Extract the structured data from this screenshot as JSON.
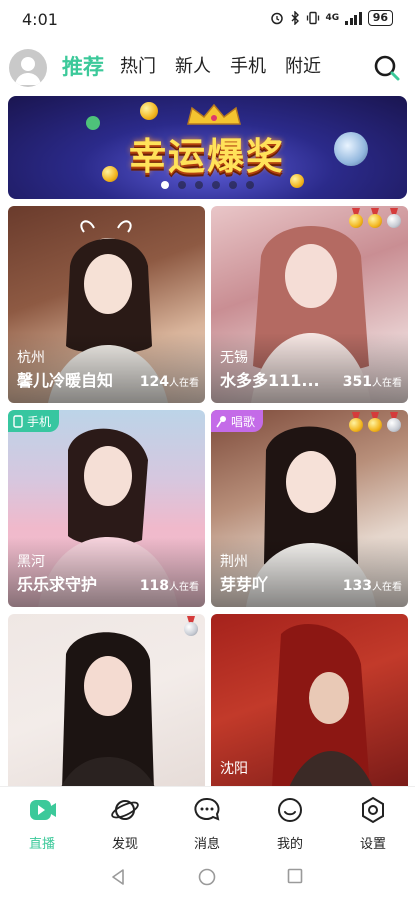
{
  "status_bar": {
    "time": "4:01",
    "network": "4G",
    "battery": "96",
    "icons": [
      "alarm-icon",
      "bluetooth-icon",
      "vibrate-icon",
      "signal-icon",
      "battery-icon"
    ]
  },
  "top_nav": {
    "tabs": [
      {
        "label": "推荐",
        "active": true
      },
      {
        "label": "热门",
        "active": false
      },
      {
        "label": "新人",
        "active": false
      },
      {
        "label": "手机",
        "active": false
      },
      {
        "label": "附近",
        "active": false
      }
    ],
    "accent_color": "#3cc99a",
    "search_icon": "search-icon",
    "avatar_icon": "default-avatar-icon"
  },
  "banner": {
    "title": "幸运爆奖",
    "page_count": 6,
    "active_page": 1
  },
  "cards": [
    {
      "city": "杭州",
      "name": "馨儿冷暖自知",
      "viewer_count": "124",
      "viewer_suffix": "人在看",
      "tag": "",
      "medals": []
    },
    {
      "city": "无锡",
      "name": "水多多111...",
      "viewer_count": "351",
      "viewer_suffix": "人在看",
      "tag": "",
      "medals": [
        "gold",
        "gold",
        "silver"
      ]
    },
    {
      "city": "黑河",
      "name": "乐乐求守护",
      "viewer_count": "118",
      "viewer_suffix": "人在看",
      "tag": "手机",
      "medals": []
    },
    {
      "city": "荆州",
      "name": "芽芽吖",
      "viewer_count": "133",
      "viewer_suffix": "人在看",
      "tag": "唱歌",
      "medals": [
        "gold",
        "gold",
        "silver"
      ]
    },
    {
      "city": "",
      "name": "",
      "viewer_count": "",
      "viewer_suffix": "",
      "tag": "",
      "medals": [
        "silver"
      ]
    },
    {
      "city": "沈阳",
      "name": "",
      "viewer_count": "",
      "viewer_suffix": "",
      "tag": "",
      "medals": []
    }
  ],
  "bottom_nav": {
    "items": [
      {
        "label": "直播",
        "icon": "live-icon",
        "active": true
      },
      {
        "label": "发现",
        "icon": "planet-icon",
        "active": false
      },
      {
        "label": "消息",
        "icon": "message-icon",
        "active": false
      },
      {
        "label": "我的",
        "icon": "smile-icon",
        "active": false
      },
      {
        "label": "设置",
        "icon": "settings-icon",
        "active": false
      }
    ]
  },
  "system_nav": {
    "icons": [
      "back-icon",
      "home-icon",
      "recents-icon"
    ]
  }
}
